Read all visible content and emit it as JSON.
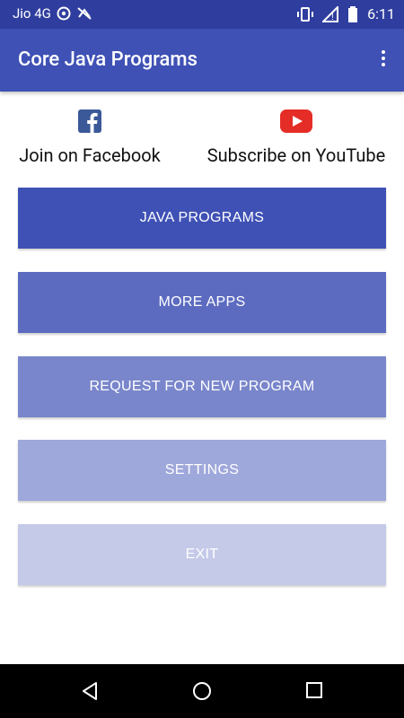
{
  "status": {
    "carrier": "Jio 4G",
    "time": "6:11"
  },
  "appbar": {
    "title": "Core Java Programs"
  },
  "social": {
    "facebook_label": "Join on Facebook",
    "youtube_label": "Subscribe on YouTube"
  },
  "buttons": {
    "java_programs": "JAVA PROGRAMS",
    "more_apps": "MORE APPS",
    "request": "REQUEST FOR NEW PROGRAM",
    "settings": "SETTINGS",
    "exit": "EXIT"
  },
  "colors": {
    "primary_dark": "#2f3e9e",
    "primary": "#3f51b5",
    "button2": "#5c6bc0",
    "button3": "#7986cb",
    "button4": "#9fa8da",
    "button5": "#c5cae9",
    "facebook": "#3b5998",
    "youtube": "#e52d27"
  }
}
